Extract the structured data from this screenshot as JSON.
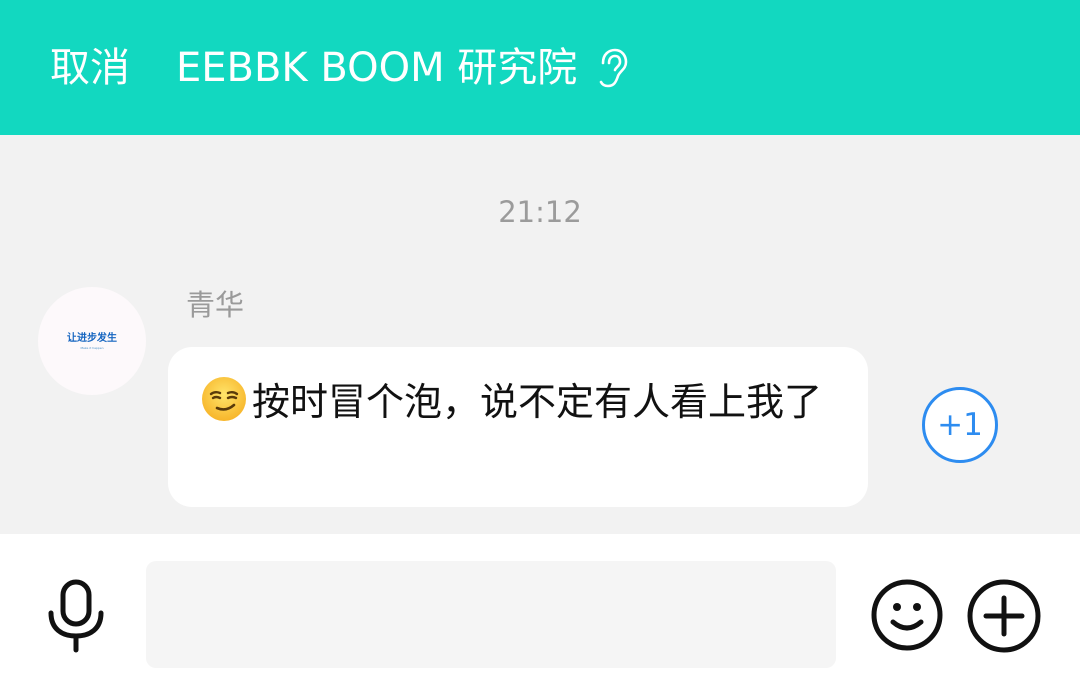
{
  "header": {
    "cancel_label": "取消",
    "title": "EEBBK BOOM 研究院",
    "background": "#12d8c0",
    "icon": "ear-icon"
  },
  "chat": {
    "timestamp": "21:12",
    "messages": [
      {
        "sender": "青华",
        "avatar_text": "让进步发生",
        "avatar_subtext": "Make it happen",
        "emoji": "smirking-face",
        "text": "按时冒个泡，说不定有人看上我了",
        "reaction_label": "+1"
      }
    ]
  },
  "footer": {
    "input_placeholder": "",
    "input_value": "",
    "icons": [
      "microphone-icon",
      "emoji-icon",
      "plus-icon"
    ]
  },
  "colors": {
    "accent": "#12d8c0",
    "reaction": "#2d8cf0",
    "background": "#f2f2f2"
  }
}
